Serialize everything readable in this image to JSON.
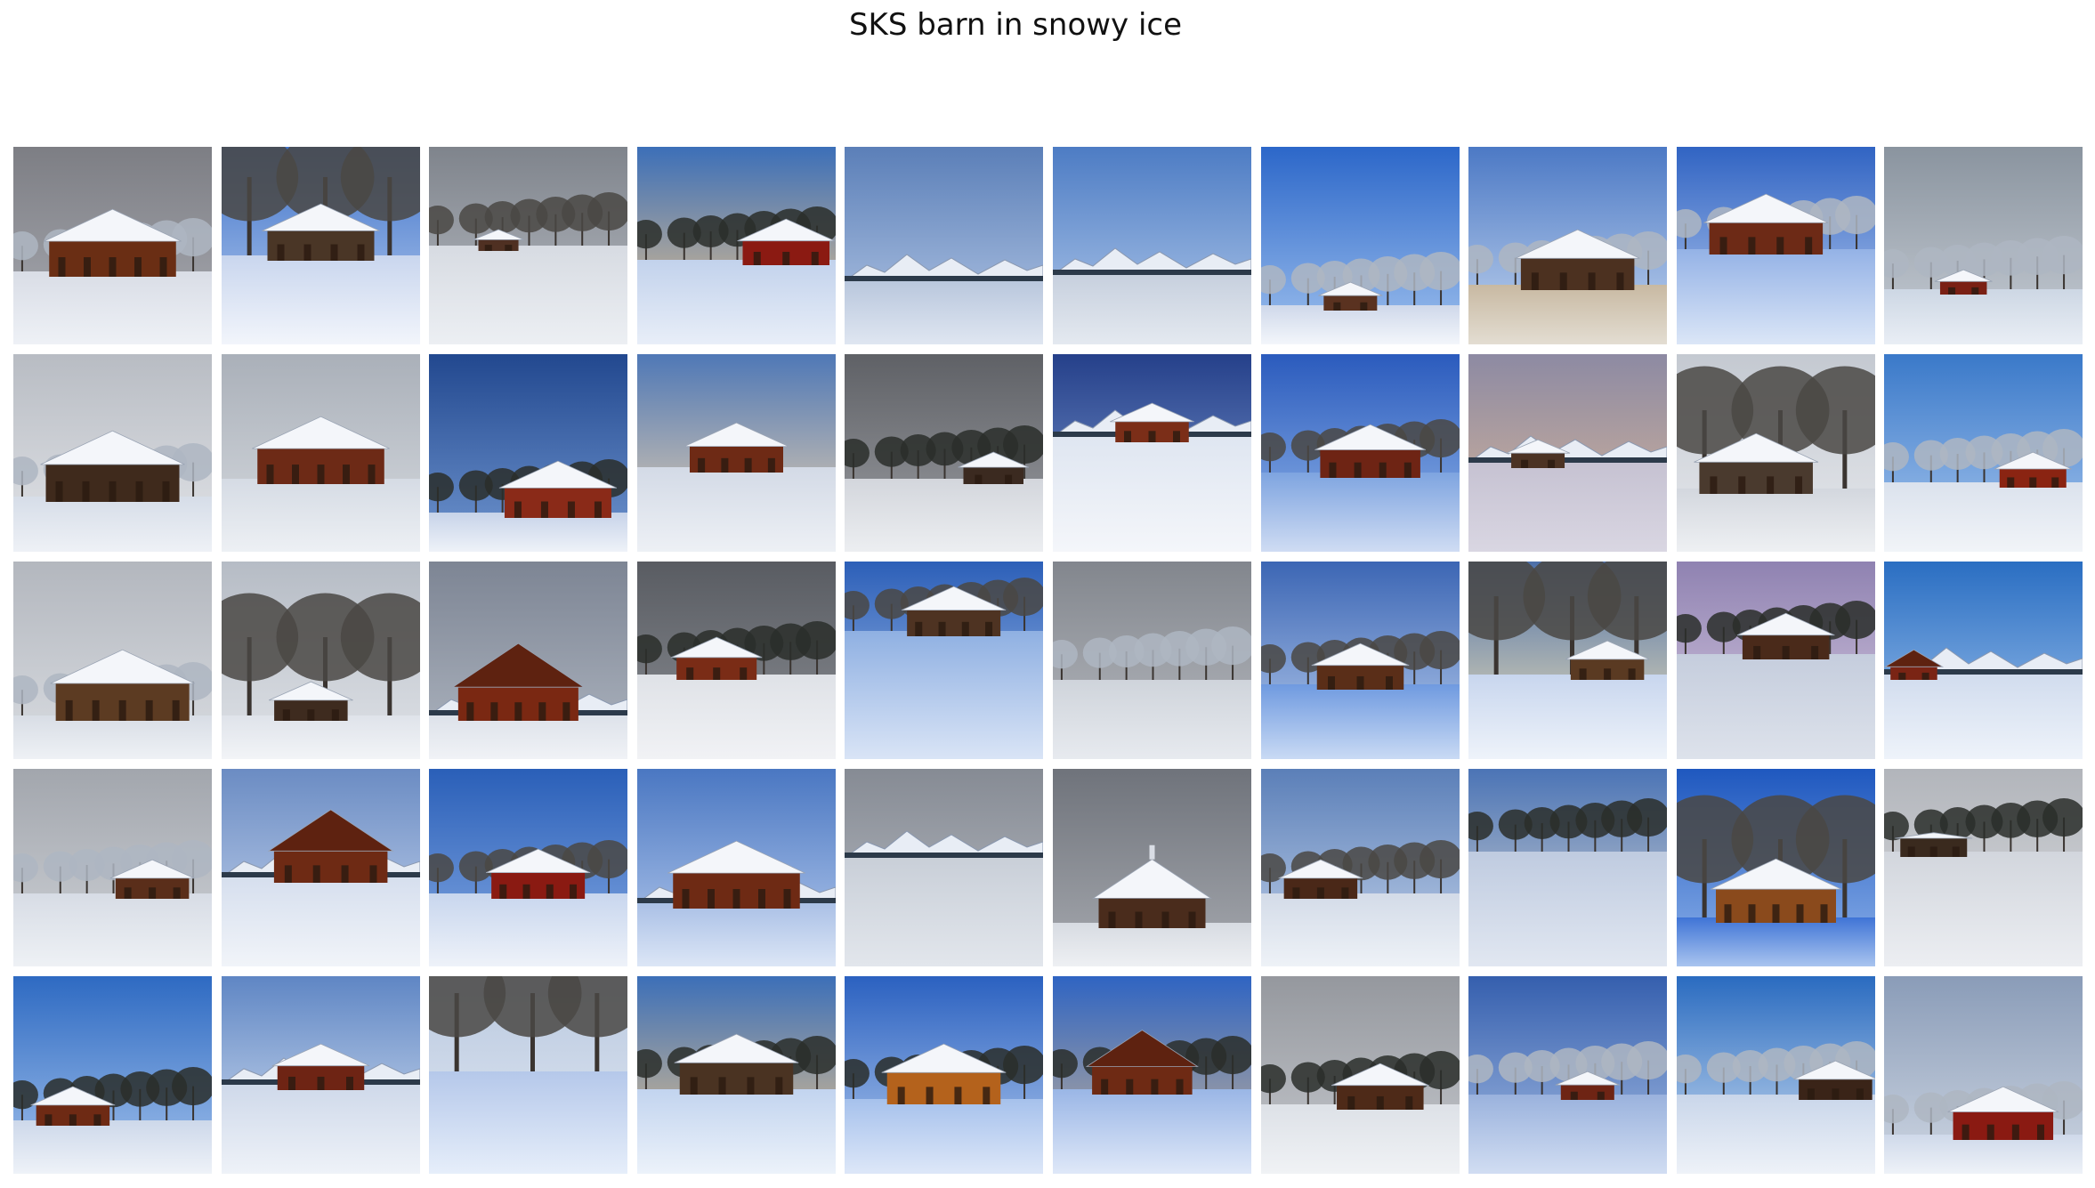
{
  "title": "SKS barn in snowy ice",
  "grid": {
    "rows": 5,
    "cols": 10,
    "tiles": [
      {
        "row": 0,
        "col": 0,
        "sky": [
          "#7d7e84",
          "#a9abb2"
        ],
        "ground": [
          "#d9dde6",
          "#eef1f6"
        ],
        "horizon": 0.63,
        "trees": "frost",
        "barn": {
          "color": "#6a2e14",
          "roof": "snow-hip",
          "size": 0.95,
          "pos": 0.5
        }
      },
      {
        "row": 0,
        "col": 1,
        "sky": [
          "#3f72c9",
          "#b9cff0"
        ],
        "ground": [
          "#c9d6ee",
          "#f2f5fb"
        ],
        "horizon": 0.55,
        "trees": "bare-big",
        "barn": {
          "color": "#4a3626",
          "roof": "snow",
          "size": 0.8,
          "pos": 0.5
        }
      },
      {
        "row": 0,
        "col": 2,
        "sky": [
          "#7f848c",
          "#b8bcc3"
        ],
        "ground": [
          "#d7dbe2",
          "#eceff3"
        ],
        "horizon": 0.5,
        "trees": "bare",
        "barn": {
          "color": "#4f3022",
          "roof": "snow",
          "size": 0.3,
          "pos": 0.35
        }
      },
      {
        "row": 0,
        "col": 3,
        "sky": [
          "#3c6fb8",
          "#f4c98a"
        ],
        "ground": [
          "#c2d2ec",
          "#e8eef8"
        ],
        "horizon": 0.57,
        "trees": "dark",
        "barn": {
          "color": "#8b1a12",
          "roof": "snow",
          "size": 0.65,
          "pos": 0.75
        }
      },
      {
        "row": 0,
        "col": 4,
        "sky": [
          "#5b7fb8",
          "#b6c9e6"
        ],
        "ground": [
          "#b9c7dd",
          "#dfe6f1"
        ],
        "horizon": 0.68,
        "trees": "mountains",
        "barn": null
      },
      {
        "row": 0,
        "col": 5,
        "sky": [
          "#4d7cc4",
          "#b4cbeb"
        ],
        "ground": [
          "#c7d0de",
          "#e4e9f0"
        ],
        "horizon": 0.65,
        "trees": "mountains",
        "barn": null
      },
      {
        "row": 0,
        "col": 6,
        "sky": [
          "#2c67c9",
          "#9fc1ee"
        ],
        "ground": [
          "#cfd8ea",
          "#f3f6fb"
        ],
        "horizon": 0.8,
        "trees": "frost",
        "barn": {
          "color": "#5a3220",
          "roof": "snow",
          "size": 0.4,
          "pos": 0.45
        }
      },
      {
        "row": 0,
        "col": 7,
        "sky": [
          "#4c79c5",
          "#c4d6ef"
        ],
        "ground": [
          "#c8b9a2",
          "#e3ddd2"
        ],
        "horizon": 0.7,
        "trees": "frost",
        "barn": {
          "color": "#4c3120",
          "roof": "snow-wide",
          "size": 0.85,
          "pos": 0.55
        }
      },
      {
        "row": 0,
        "col": 8,
        "sky": [
          "#3164c3",
          "#b8cdf0"
        ],
        "ground": [
          "#94b2e6",
          "#dbe6f7"
        ],
        "horizon": 0.52,
        "trees": "frost",
        "barn": {
          "color": "#6d2a16",
          "roof": "snow-wide",
          "size": 0.85,
          "pos": 0.45
        }
      },
      {
        "row": 0,
        "col": 9,
        "sky": [
          "#8a949f",
          "#c7cdd5"
        ],
        "ground": [
          "#cdd7e4",
          "#e9eef5"
        ],
        "horizon": 0.72,
        "trees": "frost",
        "barn": {
          "color": "#7a2014",
          "roof": "snow",
          "size": 0.35,
          "pos": 0.4
        }
      },
      {
        "row": 1,
        "col": 0,
        "sky": [
          "#b8bcc3",
          "#e2e4e8"
        ],
        "ground": [
          "#d6dde8",
          "#eef1f6"
        ],
        "horizon": 0.72,
        "trees": "frost",
        "barn": {
          "color": "#3f2a1c",
          "roof": "snow-big",
          "size": 1.0,
          "pos": 0.5
        }
      },
      {
        "row": 1,
        "col": 1,
        "sky": [
          "#aab0b9",
          "#d6dadf"
        ],
        "ground": [
          "#d5dbe4",
          "#edf0f4"
        ],
        "horizon": 0.63,
        "trees": "none",
        "barn": {
          "color": "#6d2a16",
          "roof": "double",
          "size": 0.95,
          "pos": 0.5
        }
      },
      {
        "row": 1,
        "col": 2,
        "sky": [
          "#22488f",
          "#6f95cf"
        ],
        "ground": [
          "#c7d3e9",
          "#eef2f8"
        ],
        "horizon": 0.8,
        "trees": "dark",
        "barn": {
          "color": "#8a2a18",
          "roof": "snow-side",
          "size": 0.8,
          "pos": 0.65
        }
      },
      {
        "row": 1,
        "col": 3,
        "sky": [
          "#4f78b6",
          "#f0d6b0"
        ],
        "ground": [
          "#d3dae6",
          "#edf0f5"
        ],
        "horizon": 0.57,
        "trees": "none",
        "barn": {
          "color": "#6e2a15",
          "roof": "snow",
          "size": 0.7,
          "pos": 0.5
        }
      },
      {
        "row": 1,
        "col": 4,
        "sky": [
          "#5f6166",
          "#9b9da2"
        ],
        "ground": [
          "#d3d6dc",
          "#eceef1"
        ],
        "horizon": 0.63,
        "trees": "dark",
        "barn": {
          "color": "#3b2a20",
          "roof": "snow",
          "size": 0.45,
          "pos": 0.75
        }
      },
      {
        "row": 1,
        "col": 5,
        "sky": [
          "#25408a",
          "#7f9bd0"
        ],
        "ground": [
          "#dfe6f1",
          "#f4f6fa"
        ],
        "horizon": 0.42,
        "trees": "mountains",
        "barn": {
          "color": "#7b2e18",
          "roof": "snow",
          "size": 0.55,
          "pos": 0.5
        }
      },
      {
        "row": 1,
        "col": 6,
        "sky": [
          "#2b5bbd",
          "#93b7ea"
        ],
        "ground": [
          "#7ea4e0",
          "#cfdcf3"
        ],
        "horizon": 0.6,
        "trees": "bare",
        "barn": {
          "color": "#6e2414",
          "roof": "snow",
          "size": 0.75,
          "pos": 0.55
        }
      },
      {
        "row": 1,
        "col": 7,
        "sky": [
          "#8d8aa3",
          "#d8b79a"
        ],
        "ground": [
          "#c6c2d2",
          "#d9d6e2"
        ],
        "horizon": 0.55,
        "trees": "mountains",
        "barn": {
          "color": "#4c3324",
          "roof": "snow",
          "size": 0.4,
          "pos": 0.35
        }
      },
      {
        "row": 1,
        "col": 8,
        "sky": [
          "#c4c9d1",
          "#e6e8ec"
        ],
        "ground": [
          "#d3d7de",
          "#eef0f3"
        ],
        "horizon": 0.68,
        "trees": "bare-big",
        "barn": {
          "color": "#4a3a2e",
          "roof": "snow-big",
          "size": 0.85,
          "pos": 0.4
        }
      },
      {
        "row": 1,
        "col": 9,
        "sky": [
          "#3a79c9",
          "#a7c6ee"
        ],
        "ground": [
          "#dbe2ed",
          "#f1f4f8"
        ],
        "horizon": 0.65,
        "trees": "frost",
        "barn": {
          "color": "#8a2412",
          "roof": "snow",
          "size": 0.5,
          "pos": 0.75
        }
      },
      {
        "row": 2,
        "col": 0,
        "sky": [
          "#b3b7be",
          "#d9dce1"
        ],
        "ground": [
          "#d8dde5",
          "#eef1f5"
        ],
        "horizon": 0.78,
        "trees": "frost",
        "barn": {
          "color": "#5c3b22",
          "roof": "snow-wide",
          "size": 1.0,
          "pos": 0.55
        }
      },
      {
        "row": 2,
        "col": 1,
        "sky": [
          "#b6bcc5",
          "#dfe2e7"
        ],
        "ground": [
          "#dfe3ea",
          "#f2f4f7"
        ],
        "horizon": 0.78,
        "trees": "bare-big",
        "barn": {
          "color": "#3e2b1f",
          "roof": "snow",
          "size": 0.55,
          "pos": 0.45
        }
      },
      {
        "row": 2,
        "col": 2,
        "sky": [
          "#7d8594",
          "#aeb5c0"
        ],
        "ground": [
          "#dde2ea",
          "#f0f2f6"
        ],
        "horizon": 0.78,
        "trees": "mountains",
        "barn": {
          "color": "#7a2812",
          "roof": "gable",
          "size": 0.9,
          "pos": 0.45
        }
      },
      {
        "row": 2,
        "col": 3,
        "sky": [
          "#595c62",
          "#8a8d93"
        ],
        "ground": [
          "#dfe2e7",
          "#f1f2f5"
        ],
        "horizon": 0.57,
        "trees": "dark",
        "barn": {
          "color": "#7a2c16",
          "roof": "snow",
          "size": 0.6,
          "pos": 0.4
        }
      },
      {
        "row": 2,
        "col": 4,
        "sky": [
          "#2c5fb8",
          "#a8c3ea"
        ],
        "ground": [
          "#8fb0e2",
          "#d9e4f6"
        ],
        "horizon": 0.35,
        "trees": "bare",
        "barn": {
          "color": "#4e3322",
          "roof": "snow",
          "size": 0.7,
          "pos": 0.55
        }
      },
      {
        "row": 2,
        "col": 5,
        "sky": [
          "#82868d",
          "#b7bac0"
        ],
        "ground": [
          "#cfd4db",
          "#e7eaef"
        ],
        "horizon": 0.6,
        "trees": "frost",
        "barn": null
      },
      {
        "row": 2,
        "col": 6,
        "sky": [
          "#3c66b4",
          "#b8cdee"
        ],
        "ground": [
          "#6f9ae0",
          "#c9daf4"
        ],
        "horizon": 0.62,
        "trees": "bare",
        "barn": {
          "color": "#5a2e18",
          "roof": "snow",
          "size": 0.65,
          "pos": 0.5
        }
      },
      {
        "row": 2,
        "col": 7,
        "sky": [
          "#4c6fa9",
          "#f5e6b8"
        ],
        "ground": [
          "#c8d6ee",
          "#eef3fa"
        ],
        "horizon": 0.57,
        "trees": "bare-big",
        "barn": {
          "color": "#5a3a22",
          "roof": "snow",
          "size": 0.55,
          "pos": 0.7
        }
      },
      {
        "row": 2,
        "col": 8,
        "sky": [
          "#8f82b1",
          "#d8cbe2"
        ],
        "ground": [
          "#c5cddd",
          "#dde2eb"
        ],
        "horizon": 0.47,
        "trees": "dark",
        "barn": {
          "color": "#4a2a1a",
          "roof": "snow-wide",
          "size": 0.65,
          "pos": 0.55
        }
      },
      {
        "row": 2,
        "col": 9,
        "sky": [
          "#2a6ec2",
          "#a2c5ee"
        ],
        "ground": [
          "#d1dcee",
          "#eef3fa"
        ],
        "horizon": 0.57,
        "trees": "mountains",
        "barn": {
          "color": "#7a2414",
          "roof": "gable",
          "size": 0.35,
          "pos": 0.15
        }
      },
      {
        "row": 3,
        "col": 0,
        "sky": [
          "#a2a6ad",
          "#cfd2d7"
        ],
        "ground": [
          "#d7dce5",
          "#eef1f5"
        ],
        "horizon": 0.63,
        "trees": "frost",
        "barn": {
          "color": "#5a2e1a",
          "roof": "snow",
          "size": 0.55,
          "pos": 0.7
        }
      },
      {
        "row": 3,
        "col": 1,
        "sky": [
          "#6b8cc3",
          "#c7d6ef"
        ],
        "ground": [
          "#d6dfee",
          "#f1f4f9"
        ],
        "horizon": 0.55,
        "trees": "mountains",
        "barn": {
          "color": "#6e2a14",
          "roof": "gable-big",
          "size": 0.85,
          "pos": 0.55
        }
      },
      {
        "row": 3,
        "col": 2,
        "sky": [
          "#2a5fb8",
          "#84a9e3"
        ],
        "ground": [
          "#c8d6ee",
          "#eef2f9"
        ],
        "horizon": 0.63,
        "trees": "bare",
        "barn": {
          "color": "#8a1a12",
          "roof": "snow",
          "size": 0.7,
          "pos": 0.55
        }
      },
      {
        "row": 3,
        "col": 3,
        "sky": [
          "#4a77c2",
          "#b9cdee"
        ],
        "ground": [
          "#aac0e6",
          "#dce6f6"
        ],
        "horizon": 0.68,
        "trees": "mountains",
        "barn": {
          "color": "#6e2a14",
          "roof": "snow-big",
          "size": 0.95,
          "pos": 0.5
        }
      },
      {
        "row": 3,
        "col": 4,
        "sky": [
          "#868b94",
          "#b8bcc3"
        ],
        "ground": [
          "#c9cfd8",
          "#e2e6ec"
        ],
        "horizon": 0.45,
        "trees": "mountains",
        "barn": null
      },
      {
        "row": 3,
        "col": 5,
        "sky": [
          "#6f737b",
          "#a6a9af"
        ],
        "ground": [
          "#d7dbe2",
          "#eef0f3"
        ],
        "horizon": 0.78,
        "trees": "none",
        "barn": {
          "color": "#4a2c1c",
          "roof": "snow-church",
          "size": 0.8,
          "pos": 0.5
        }
      },
      {
        "row": 3,
        "col": 6,
        "sky": [
          "#5b7fb8",
          "#c2d2ea"
        ],
        "ground": [
          "#d3dbe8",
          "#eef2f7"
        ],
        "horizon": 0.63,
        "trees": "bare",
        "barn": {
          "color": "#4a2818",
          "roof": "snow",
          "size": 0.55,
          "pos": 0.3
        }
      },
      {
        "row": 3,
        "col": 7,
        "sky": [
          "#4b74b6",
          "#dad8d2"
        ],
        "ground": [
          "#bfcbe0",
          "#e1e7f1"
        ],
        "horizon": 0.42,
        "trees": "dark",
        "barn": null
      },
      {
        "row": 3,
        "col": 8,
        "sky": [
          "#1f58bf",
          "#8db2ea"
        ],
        "ground": [
          "#3f74d6",
          "#a9c4ef"
        ],
        "horizon": 0.75,
        "trees": "bare-big",
        "barn": {
          "color": "#8a4a1c",
          "roof": "snow-big",
          "size": 0.9,
          "pos": 0.5
        }
      },
      {
        "row": 3,
        "col": 9,
        "sky": [
          "#b2b5bb",
          "#dadcdf"
        ],
        "ground": [
          "#d2d6dd",
          "#eceef2"
        ],
        "horizon": 0.42,
        "trees": "dark",
        "barn": {
          "color": "#3a2a1e",
          "roof": "flat",
          "size": 0.5,
          "pos": 0.25
        }
      },
      {
        "row": 4,
        "col": 0,
        "sky": [
          "#2e6ac2",
          "#a3c2ec"
        ],
        "ground": [
          "#cdd8ea",
          "#eef2f8"
        ],
        "horizon": 0.73,
        "trees": "dark",
        "barn": {
          "color": "#6e2a14",
          "roof": "snow",
          "size": 0.55,
          "pos": 0.3
        }
      },
      {
        "row": 4,
        "col": 1,
        "sky": [
          "#5f86c4",
          "#d9e4f3"
        ],
        "ground": [
          "#cfd9ea",
          "#eef2f8"
        ],
        "horizon": 0.55,
        "trees": "mountains",
        "barn": {
          "color": "#6e2414",
          "roof": "snow",
          "size": 0.65,
          "pos": 0.5
        }
      },
      {
        "row": 4,
        "col": 2,
        "sky": [
          "#b9c8df",
          "#e2e9f3"
        ],
        "ground": [
          "#b5c8ea",
          "#e6eefa"
        ],
        "horizon": 0.48,
        "trees": "bare-big",
        "barn": null
      },
      {
        "row": 4,
        "col": 3,
        "sky": [
          "#3c6fb8",
          "#f2c98a"
        ],
        "ground": [
          "#c2d4ef",
          "#ecf2fa"
        ],
        "horizon": 0.57,
        "trees": "dark",
        "barn": {
          "color": "#4a3322",
          "roof": "snow-wide",
          "size": 0.85,
          "pos": 0.5
        }
      },
      {
        "row": 4,
        "col": 4,
        "sky": [
          "#2b61c0",
          "#b0c9ee"
        ],
        "ground": [
          "#a6c1ec",
          "#dde7f8"
        ],
        "horizon": 0.62,
        "trees": "dark",
        "barn": {
          "color": "#b4621c",
          "roof": "snow-wide",
          "size": 0.85,
          "pos": 0.5
        }
      },
      {
        "row": 4,
        "col": 5,
        "sky": [
          "#2f64c2",
          "#c9b497"
        ],
        "ground": [
          "#9ab6e6",
          "#dfe8f8"
        ],
        "horizon": 0.57,
        "trees": "dark",
        "barn": {
          "color": "#6e2a14",
          "roof": "gable-big",
          "size": 0.75,
          "pos": 0.45
        }
      },
      {
        "row": 4,
        "col": 6,
        "sky": [
          "#95989e",
          "#c5c8cd"
        ],
        "ground": [
          "#dde1e7",
          "#f0f2f5"
        ],
        "horizon": 0.65,
        "trees": "dark",
        "barn": {
          "color": "#4e2a18",
          "roof": "snow",
          "size": 0.65,
          "pos": 0.6
        }
      },
      {
        "row": 4,
        "col": 7,
        "sky": [
          "#355fae",
          "#a6bde3"
        ],
        "ground": [
          "#9ab2dd",
          "#d1ddf2"
        ],
        "horizon": 0.6,
        "trees": "frost",
        "barn": {
          "color": "#6e2414",
          "roof": "snow",
          "size": 0.4,
          "pos": 0.6
        }
      },
      {
        "row": 4,
        "col": 8,
        "sky": [
          "#2a6bc0",
          "#cfe0f2"
        ],
        "ground": [
          "#c9d6ea",
          "#eef2f8"
        ],
        "horizon": 0.6,
        "trees": "frost",
        "barn": {
          "color": "#3a2418",
          "roof": "snow-side",
          "size": 0.55,
          "pos": 0.8
        }
      },
      {
        "row": 4,
        "col": 9,
        "sky": [
          "#8a9cb8",
          "#ced6e2"
        ],
        "ground": [
          "#cfd9ea",
          "#eef2f8"
        ],
        "horizon": 0.8,
        "trees": "frost",
        "barn": {
          "color": "#8a1a12",
          "roof": "snow",
          "size": 0.75,
          "pos": 0.6
        }
      }
    ]
  }
}
